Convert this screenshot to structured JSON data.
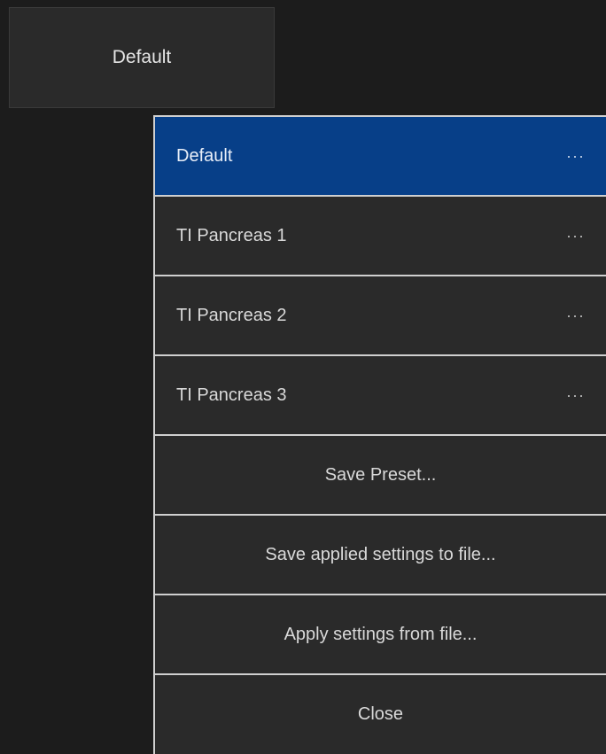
{
  "preset_selector": {
    "label": "Default"
  },
  "menu": {
    "presets": [
      {
        "label": "Default",
        "selected": true,
        "more": "···"
      },
      {
        "label": "TI Pancreas 1",
        "selected": false,
        "more": "···"
      },
      {
        "label": "TI Pancreas 2",
        "selected": false,
        "more": "···"
      },
      {
        "label": "TI Pancreas 3",
        "selected": false,
        "more": "···"
      }
    ],
    "actions": {
      "save_preset": "Save Preset...",
      "save_applied": "Save applied settings to file...",
      "apply_from_file": "Apply settings from file...",
      "close": "Close"
    }
  },
  "colors": {
    "background": "#1c1c1c",
    "menu_background": "#2a2a2a",
    "selected_background": "#073f88",
    "divider": "#cfcfcf"
  }
}
